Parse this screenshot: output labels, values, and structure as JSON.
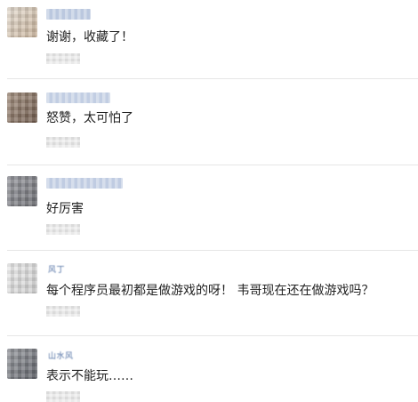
{
  "comments": [
    {
      "name": "",
      "text": "谢谢，收藏了！",
      "avatar_colors": [
        "#c9b39b",
        "#e5ddd2"
      ],
      "name_colors": [
        "#9fb2cf",
        "#c7d3e4"
      ]
    },
    {
      "name": "",
      "text": "怒赞，太可怕了",
      "avatar_colors": [
        "#6f5a4c",
        "#a79484"
      ],
      "name_colors": [
        "#a9b8d6",
        "#d0d9ea"
      ]
    },
    {
      "name": "",
      "text": "好厉害",
      "avatar_colors": [
        "#6e6f74",
        "#9a9ba1"
      ],
      "name_colors": [
        "#a6b5d3",
        "#cdd6e8"
      ]
    },
    {
      "name": "风丁",
      "text": "每个程序员最初都是做游戏的呀！ 韦哥现在还在做游戏吗？",
      "avatar_colors": [
        "#cfcfcf",
        "#ececec"
      ],
      "name_colors": [
        "#8fa3c6",
        "#c3cfe3"
      ]
    },
    {
      "name": "山水风",
      "text": "表示不能玩……",
      "avatar_colors": [
        "#5e6168",
        "#9c9ea3"
      ],
      "name_colors": [
        "#8fa3c6",
        "#c3cfe3"
      ]
    }
  ]
}
